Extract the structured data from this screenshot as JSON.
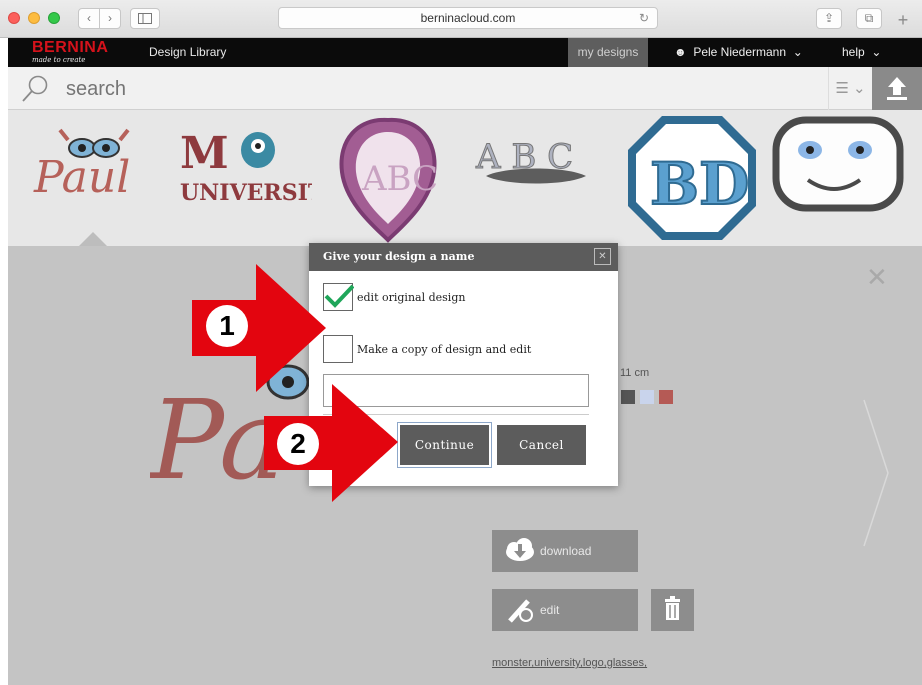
{
  "browser": {
    "url": "berninacloud.com",
    "reload_icon": "reload-icon",
    "back_icon": "chevron-left-icon",
    "forward_icon": "chevron-right-icon"
  },
  "topnav": {
    "logo": "BERNINA",
    "tagline": "made to create",
    "title": "Design Library",
    "my_designs": "my designs",
    "user": "Pele Niedermann",
    "help": "help"
  },
  "search": {
    "placeholder": "search"
  },
  "carousel": {
    "items": [
      "Paul",
      "MY UNIVERSITY",
      "ABC heart",
      "ABC",
      "BD",
      "monster face"
    ]
  },
  "detail": {
    "size_text": "11 cm",
    "tags": "monster,university,logo,glasses,",
    "download_label": "download",
    "edit_label": "edit",
    "swatch_colors": [
      "#555555",
      "#c9d4ec",
      "#b55a55"
    ]
  },
  "dialog": {
    "title": "Give your design a name",
    "option_edit_original": "edit original design",
    "option_copy": "Make a copy of design and edit",
    "name_value": "",
    "continue_label": "Continue",
    "cancel_label": "Cancel",
    "edit_original_checked": true,
    "copy_checked": false
  },
  "annotations": {
    "badge1": "1",
    "badge2": "2",
    "arrow_color": "#e3050f"
  },
  "colors": {
    "brand_red": "#d5121b",
    "nav_black": "#0b0b0b",
    "check_green": "#1fa65a"
  }
}
